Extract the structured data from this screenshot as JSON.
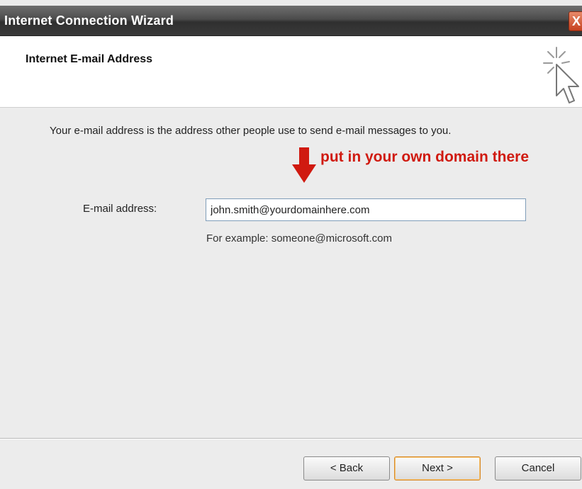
{
  "window": {
    "title": "Internet Connection Wizard",
    "close_symbol": "X"
  },
  "header": {
    "title": "Internet E-mail Address",
    "icon": "wizard-cursor-sparkle-icon"
  },
  "content": {
    "description": "Your e-mail address is the address other people use to send e-mail messages to you.",
    "annotation": "put in your own domain there",
    "email_label": "E-mail address:",
    "email_value": "john.smith@yourdomainhere.com",
    "example": "For example: someone@microsoft.com"
  },
  "buttons": {
    "back": "< Back",
    "next": "Next >",
    "cancel": "Cancel"
  },
  "colors": {
    "annotation": "#d01a10",
    "titlebar": "#3a3a3a",
    "close": "#c7421f"
  }
}
